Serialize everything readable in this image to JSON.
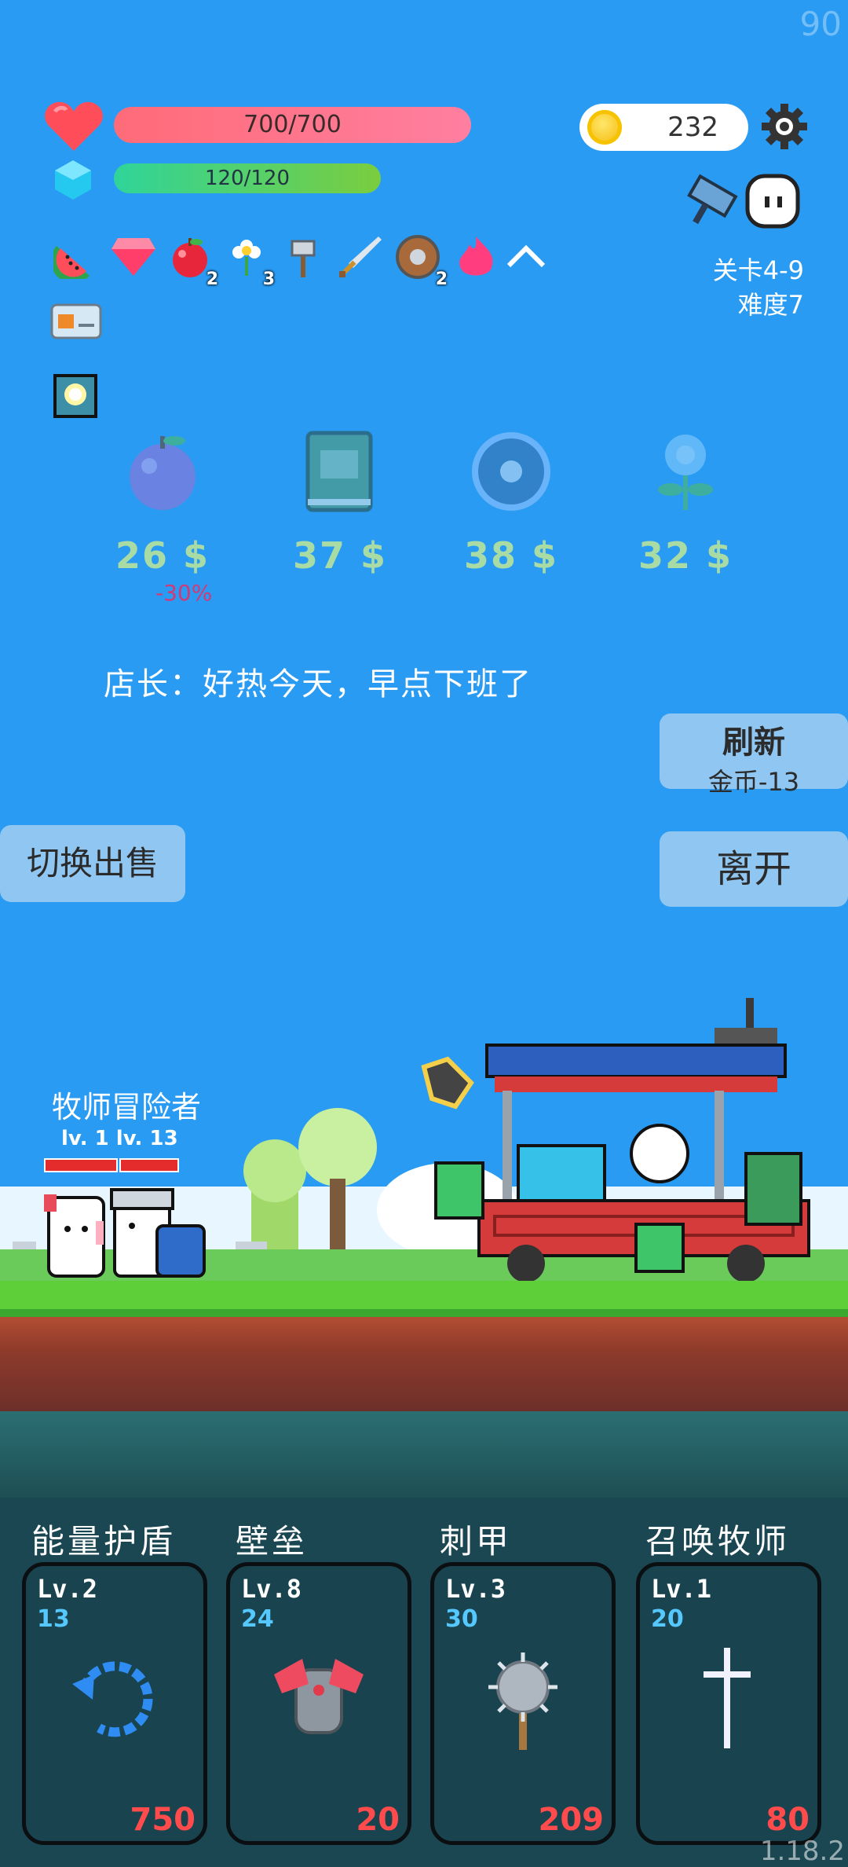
{
  "fps": "90",
  "version": "1.18.2",
  "player": {
    "hp_text": "700/700",
    "mp_text": "120/120",
    "coins": "232"
  },
  "stage": {
    "level": "关卡4-9",
    "difficulty": "难度7"
  },
  "inventory": [
    {
      "icon": "watermelon-icon",
      "count": ""
    },
    {
      "icon": "gem-icon",
      "count": ""
    },
    {
      "icon": "apple-icon",
      "count": "2"
    },
    {
      "icon": "flower-icon",
      "count": "3"
    },
    {
      "icon": "axe-icon",
      "count": ""
    },
    {
      "icon": "sword-icon",
      "count": ""
    },
    {
      "icon": "shield-icon",
      "count": "2"
    },
    {
      "icon": "flame-icon",
      "count": ""
    }
  ],
  "shop": {
    "items": [
      {
        "icon": "plum-icon",
        "price": "26 $",
        "discount": "-30%"
      },
      {
        "icon": "book-icon",
        "price": "37 $"
      },
      {
        "icon": "round-shield-icon",
        "price": "38 $"
      },
      {
        "icon": "blue-flower-icon",
        "price": "32 $"
      }
    ],
    "dialog": "店长：好热今天，早点下班了",
    "refresh_label": "刷新",
    "refresh_cost": "金币-13",
    "leave_label": "离开",
    "switch_label": "切换出售"
  },
  "units": {
    "name": "牧师冒险者",
    "levels": "lv. 1 lv. 13"
  },
  "skills": [
    {
      "title": "能量护盾",
      "level": "Lv.2",
      "value": "13",
      "cost": "750"
    },
    {
      "title": "壁垒",
      "level": "Lv.8",
      "value": "24",
      "cost": "20"
    },
    {
      "title": "刺甲",
      "level": "Lv.3",
      "value": "30",
      "cost": "209"
    },
    {
      "title": "召唤牧师",
      "level": "Lv.1",
      "value": "20",
      "cost": "80"
    }
  ]
}
